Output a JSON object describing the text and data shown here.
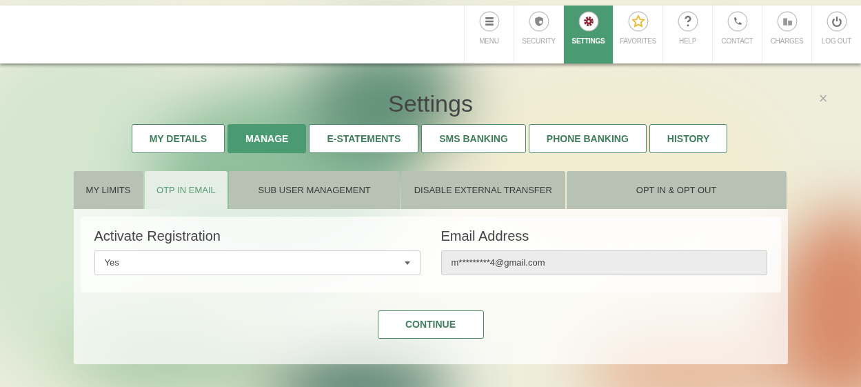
{
  "nav": [
    {
      "label": "MENU",
      "selected": false
    },
    {
      "label": "SECURITY",
      "selected": false
    },
    {
      "label": "SETTINGS",
      "selected": true
    },
    {
      "label": "FAVORITES",
      "selected": false
    },
    {
      "label": "HELP",
      "selected": false
    },
    {
      "label": "CONTACT",
      "selected": false
    },
    {
      "label": "CHARGES",
      "selected": false
    },
    {
      "label": "LOG OUT",
      "selected": false
    }
  ],
  "dialog": {
    "title": "Settings",
    "close": "×",
    "tabs": [
      {
        "label": "MY DETAILS",
        "selected": false
      },
      {
        "label": "MANAGE",
        "selected": true
      },
      {
        "label": "E-STATEMENTS",
        "selected": false
      },
      {
        "label": "SMS BANKING",
        "selected": false
      },
      {
        "label": "PHONE BANKING",
        "selected": false
      },
      {
        "label": "HISTORY",
        "selected": false
      }
    ],
    "subtabs": [
      {
        "label": "MY LIMITS",
        "selected": false
      },
      {
        "label": "OTP IN EMAIL",
        "selected": true
      },
      {
        "label": "SUB USER MANAGEMENT",
        "selected": false
      },
      {
        "label": "DISABLE EXTERNAL TRANSFER",
        "selected": false
      },
      {
        "label": "OPT IN & OPT OUT",
        "selected": false
      }
    ],
    "fields": [
      {
        "label": "Activate Registration",
        "kind": "select",
        "value": "Yes",
        "disabled": false
      },
      {
        "label": "Email Address",
        "kind": "text",
        "value": "m*********4@gmail.com",
        "disabled": true
      }
    ],
    "button": "CONTINUE"
  }
}
